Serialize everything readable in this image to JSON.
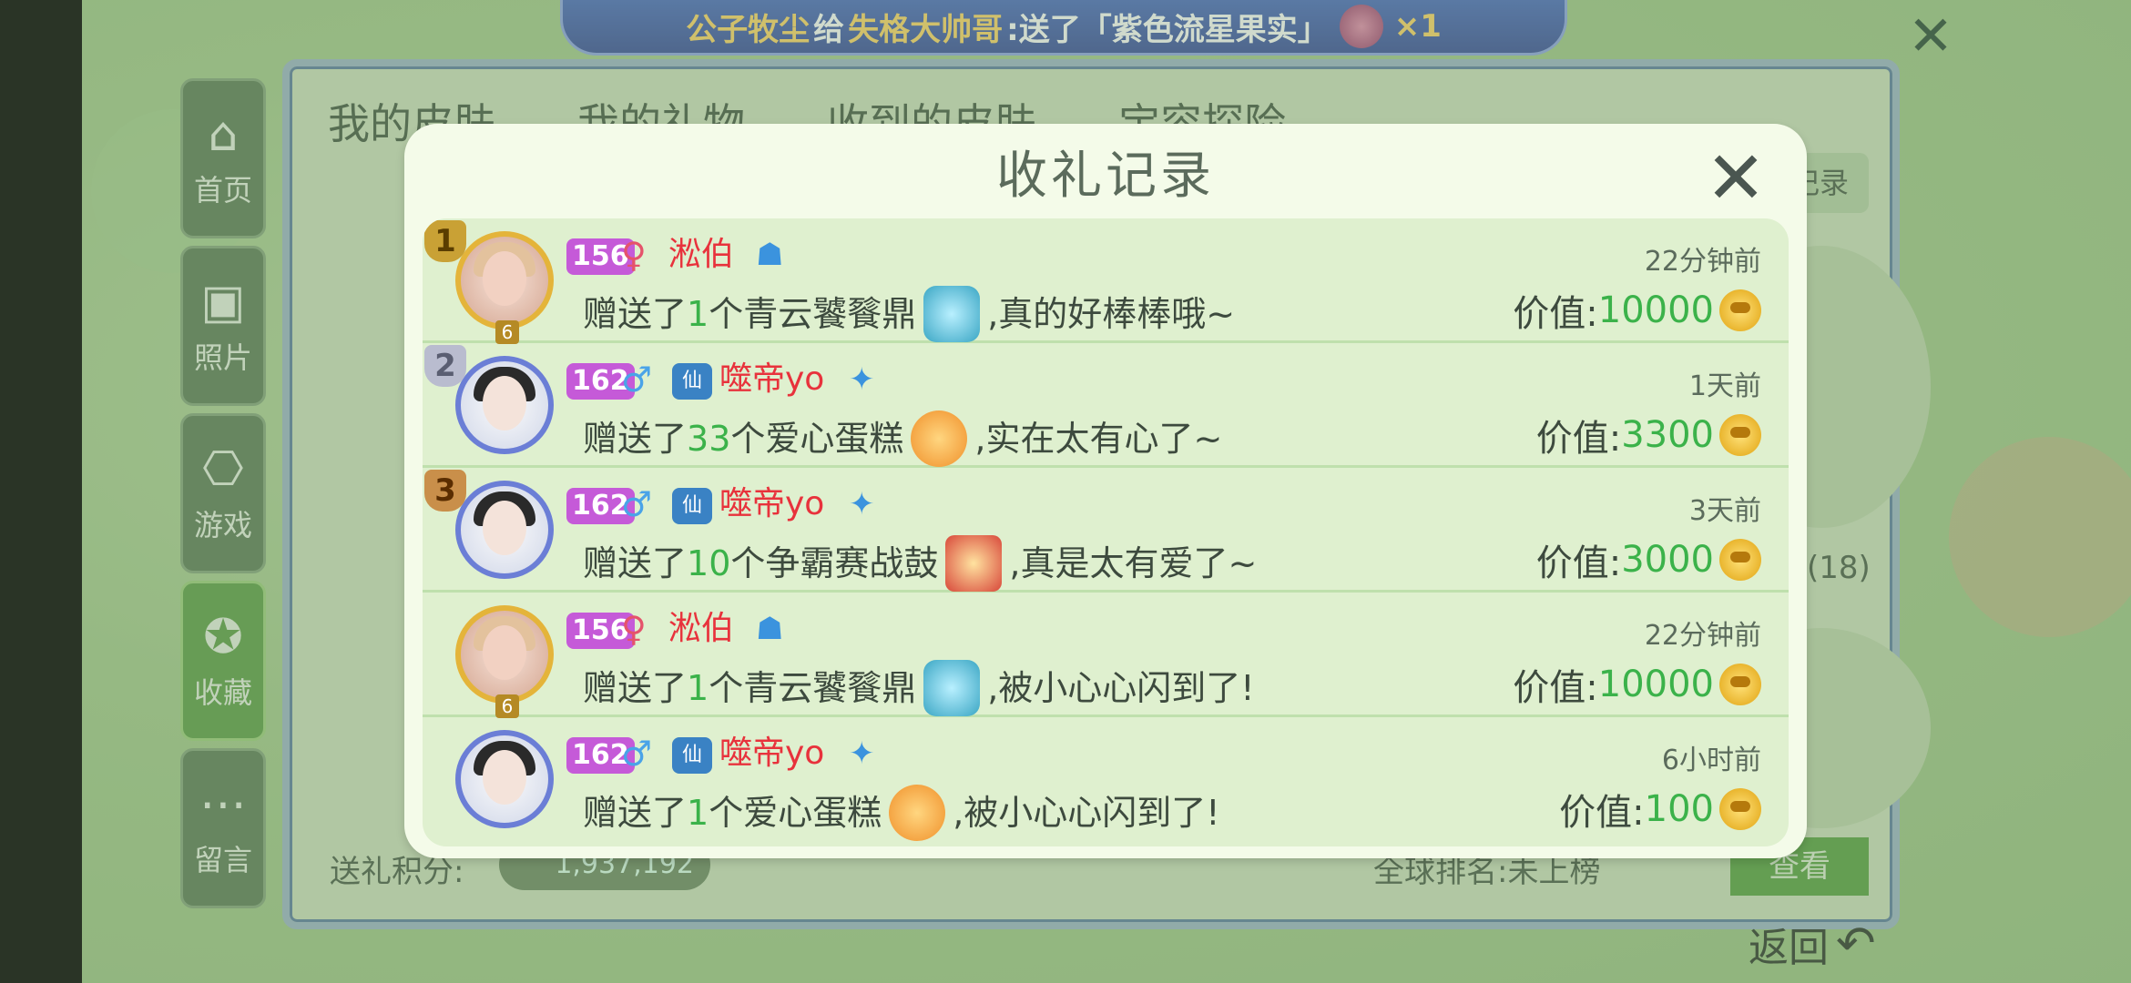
{
  "marquee": {
    "sender": "公子牧尘",
    "verb": "给",
    "receiver": "失格大帅哥",
    "sent_text": ":送了「紫色流星果实」",
    "count": "×1"
  },
  "nav": [
    {
      "label": "首页",
      "icon": "home-icon",
      "glyph": "⌂"
    },
    {
      "label": "照片",
      "icon": "photo-icon",
      "glyph": "▣"
    },
    {
      "label": "游戏",
      "icon": "gamepad-icon",
      "glyph": "⎔"
    },
    {
      "label": "收藏",
      "icon": "star-icon",
      "glyph": "✪"
    },
    {
      "label": "留言",
      "icon": "message-icon",
      "glyph": "⋯"
    }
  ],
  "background": {
    "tabs": [
      "我的皮肤",
      "我的礼物",
      "收到的皮肤",
      "宝容探险"
    ],
    "gift_record_button": "收礼记录",
    "drum_count": "鼓(18)",
    "score_label": "送礼积分:",
    "score_value": "1,937,192",
    "rank_label": "全球排名:未上榜",
    "view_button": "查看",
    "back_label": "返回"
  },
  "modal": {
    "title": "收礼记录",
    "rows": [
      {
        "rank": "1",
        "level": "156",
        "gender": "♀",
        "name": "淞伯",
        "time": "22分钟前",
        "prefix": "赠送了",
        "count": "1",
        "gift": "个青云饕餮鼎",
        "suffix": ",真的好棒棒哦~",
        "value_label": "价值:",
        "value": "10000",
        "avatar_level": "6"
      },
      {
        "rank": "2",
        "level": "162",
        "gender": "♂",
        "name": "噬帝yo",
        "time": "1天前",
        "prefix": "赠送了",
        "count": "33",
        "gift": "个爱心蛋糕",
        "suffix": ",实在太有心了~",
        "value_label": "价值:",
        "value": "3300"
      },
      {
        "rank": "3",
        "level": "162",
        "gender": "♂",
        "name": "噬帝yo",
        "time": "3天前",
        "prefix": "赠送了",
        "count": "10",
        "gift": "个争霸赛战鼓",
        "suffix": ",真是太有爱了~",
        "value_label": "价值:",
        "value": "3000"
      },
      {
        "rank": "",
        "level": "156",
        "gender": "♀",
        "name": "淞伯",
        "time": "22分钟前",
        "prefix": "赠送了",
        "count": "1",
        "gift": "个青云饕餮鼎",
        "suffix": ",被小心心闪到了!",
        "value_label": "价值:",
        "value": "10000",
        "avatar_level": "6"
      },
      {
        "rank": "",
        "level": "162",
        "gender": "♂",
        "name": "噬帝yo",
        "time": "6小时前",
        "prefix": "赠送了",
        "count": "1",
        "gift": "个爱心蛋糕",
        "suffix": ",被小心心闪到了!",
        "value_label": "价值:",
        "value": "100"
      }
    ]
  }
}
